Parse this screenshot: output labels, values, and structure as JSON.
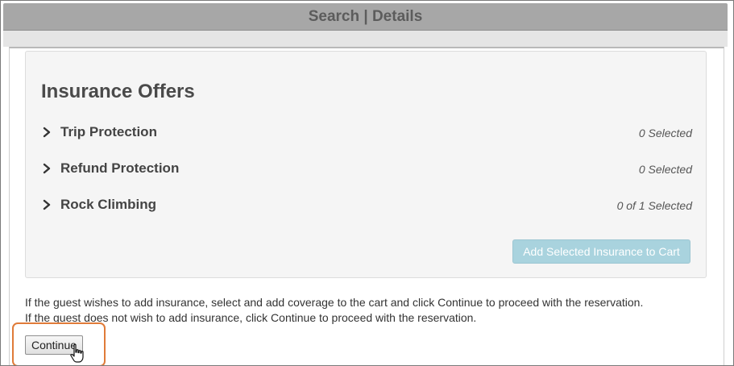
{
  "window": {
    "title": "Search | Details"
  },
  "insurance": {
    "heading": "Insurance Offers",
    "offers": [
      {
        "name": "Trip Protection",
        "status": "0 Selected"
      },
      {
        "name": "Refund Protection",
        "status": "0 Selected"
      },
      {
        "name": "Rock Climbing",
        "status": "0 of 1 Selected"
      }
    ],
    "add_button_label": "Add Selected Insurance to Cart"
  },
  "instructions": {
    "line1": "If the guest wishes to add insurance, select and add coverage to the cart and click Continue to proceed with the reservation.",
    "line2": "If the guest does not wish to add insurance, click Continue to proceed with the reservation."
  },
  "continue_button_label": "Continue",
  "icons": {
    "chevron": "chevron-right-icon",
    "cursor": "hand-pointer-icon"
  },
  "colors": {
    "title_bar": "#a7a7a7",
    "add_button": "#a9d3de",
    "highlight": "#e07b39"
  }
}
